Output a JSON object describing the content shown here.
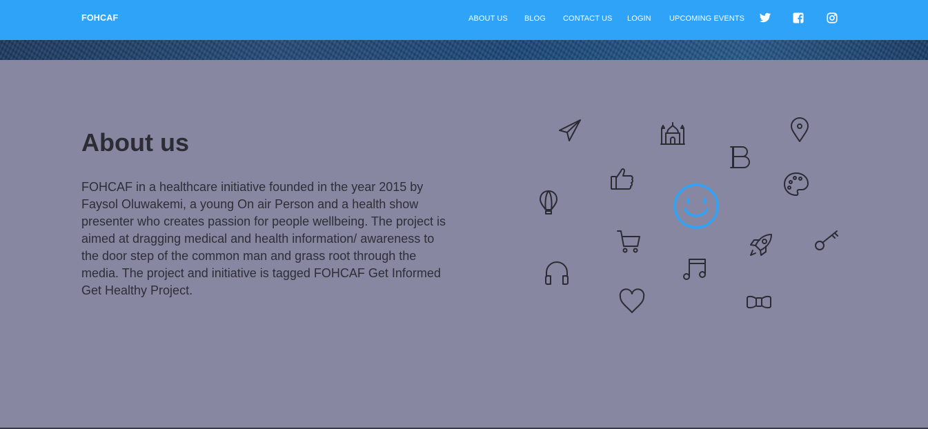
{
  "brand": "FOHCAF",
  "nav": {
    "about": "ABOUT US",
    "blog": "BLOG",
    "contact": "CONTACT US",
    "login": "LOGIN",
    "events": "UPCOMING EVENTS"
  },
  "social": [
    "twitter-icon",
    "facebook-icon",
    "instagram-icon"
  ],
  "about": {
    "title": "About us",
    "body": "FOHCAF in a healthcare initiative founded in the year 2015 by Faysol Oluwakemi, a young On air Person and a health show presenter who creates passion for people wellbeing. The project is aimed at dragging medical and health information/ awareness to the door step of the common man and grass root through the media. The project and initiative is tagged FOHCAF Get Informed Get Healthy Project."
  },
  "decor_icons": [
    "paper-plane-icon",
    "mosque-icon",
    "location-pin-icon",
    "bold-b-icon",
    "thumbs-up-icon",
    "palette-icon",
    "hot-air-balloon-icon",
    "smiley-face-icon",
    "shopping-cart-icon",
    "rocket-icon",
    "key-icon",
    "headphones-icon",
    "music-note-icon",
    "heart-icon",
    "bow-tie-icon"
  ],
  "colors": {
    "navbar": "#2ea3f8",
    "background": "#8787a2",
    "accent": "#2ea3f8",
    "text": "#2f2d36"
  }
}
